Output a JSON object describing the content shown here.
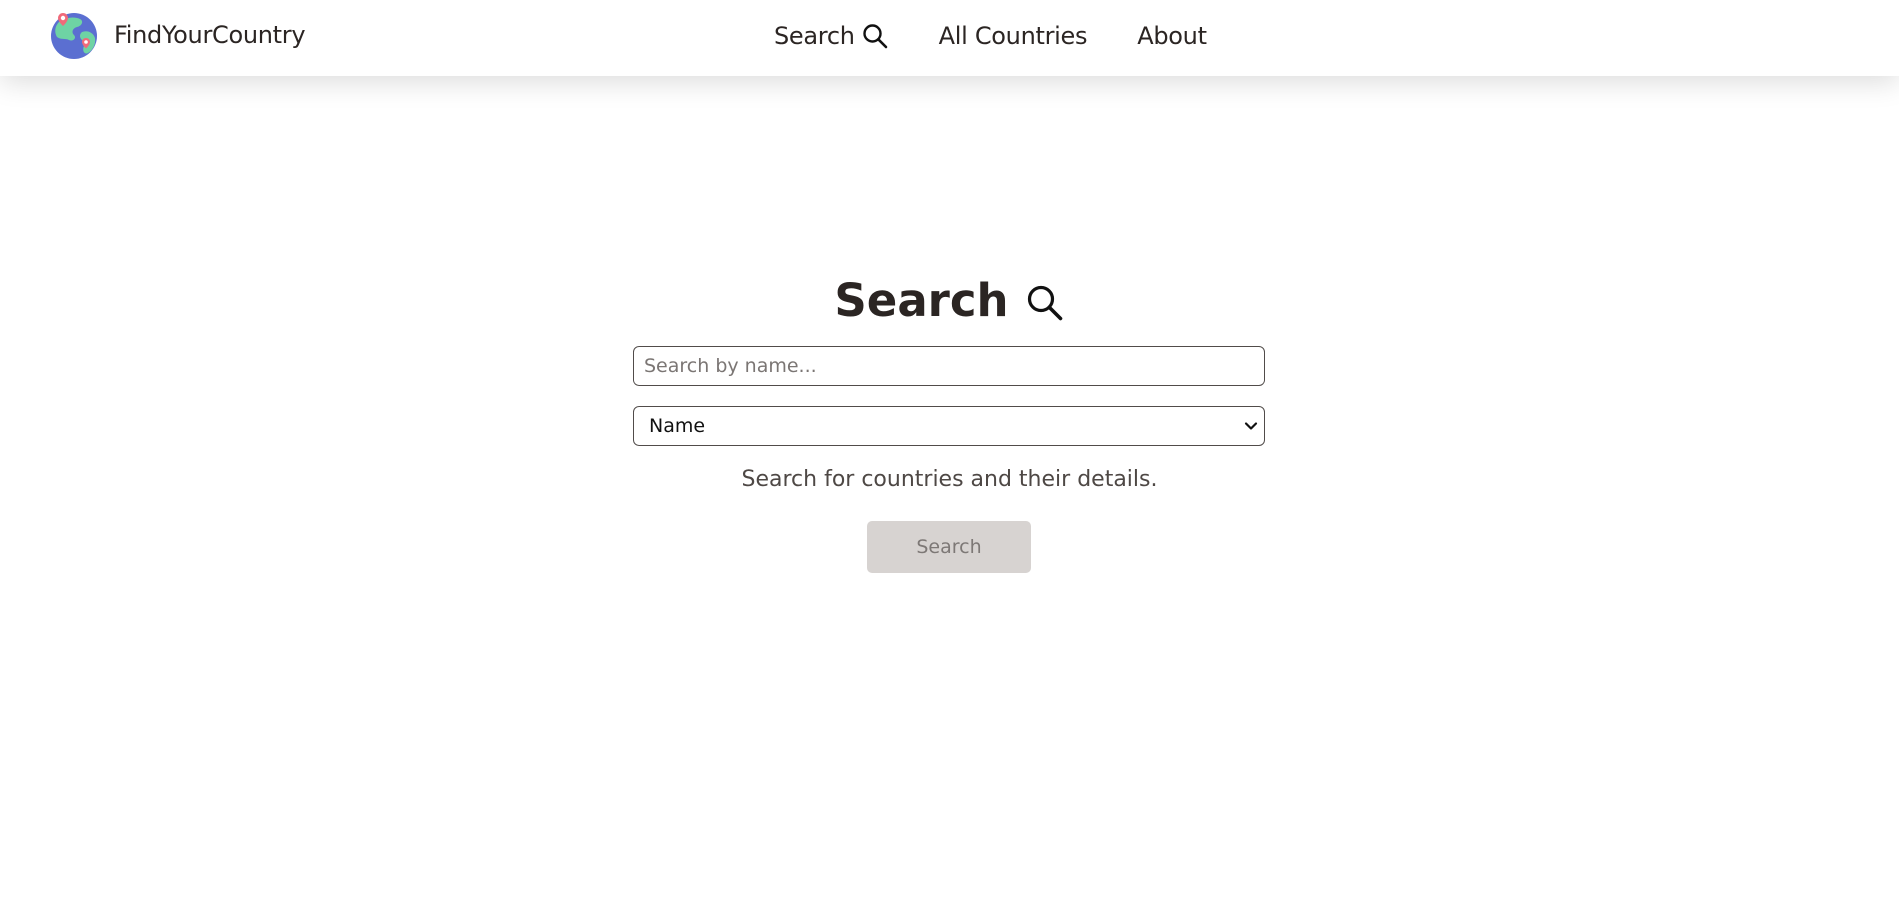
{
  "header": {
    "brand_name": "FindYourCountry",
    "logo_icon": "globe-with-pins-icon",
    "nav": [
      {
        "label": "Search",
        "icon": "search-icon"
      },
      {
        "label": "All Countries"
      },
      {
        "label": "About"
      }
    ]
  },
  "main": {
    "title": "Search",
    "title_icon": "search-icon",
    "search_input": {
      "placeholder": "Search by name...",
      "value": ""
    },
    "filter_select": {
      "selected": "Name",
      "icon": "chevron-down-icon"
    },
    "helper_text": "Search for countries and their details.",
    "submit_label": "Search",
    "submit_disabled": true
  },
  "colors": {
    "text": "#2b2523",
    "button_bg": "#d7d3d1",
    "button_text": "#7d7876",
    "globe_blue": "#5b6fd1",
    "globe_green": "#6ed3a4",
    "pin_red": "#f06a7a"
  }
}
